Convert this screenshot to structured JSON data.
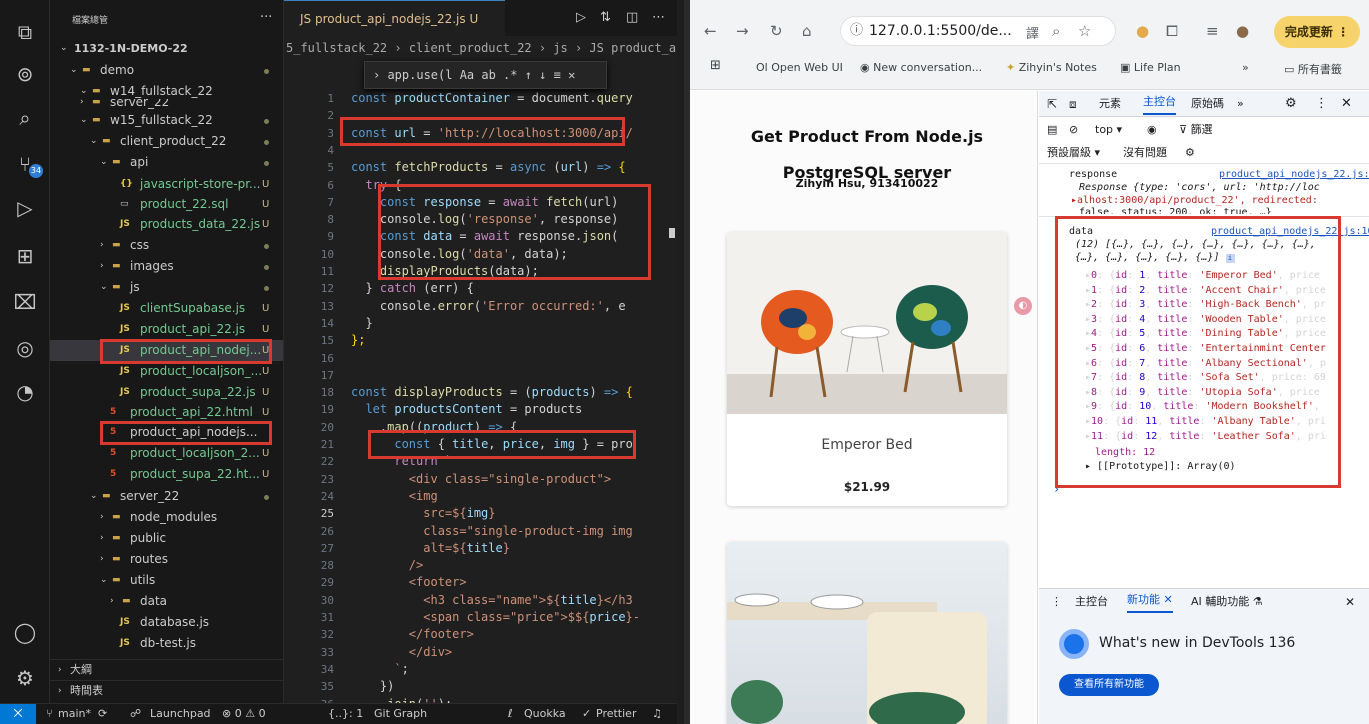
{
  "explorer": {
    "title": "檔案總管",
    "more": "···",
    "tree": [
      {
        "label": "1132-1N-DEMO-22",
        "status": "",
        "kind": "root"
      },
      {
        "label": "demo",
        "status": "dot",
        "kind": "folder"
      },
      {
        "label": "w14_fullstack_22",
        "status": "",
        "kind": "folder"
      },
      {
        "label": "server_22",
        "status": "",
        "kind": "folder"
      },
      {
        "label": "w15_fullstack_22",
        "status": "dot",
        "kind": "folder"
      },
      {
        "label": "client_product_22",
        "status": "dot",
        "kind": "folder"
      },
      {
        "label": "api",
        "status": "dot",
        "kind": "folder"
      },
      {
        "label": "javascript-store-pr...",
        "status": "U",
        "kind": "json"
      },
      {
        "label": "product_22.sql",
        "status": "U",
        "kind": "file"
      },
      {
        "label": "products_data_22.js",
        "status": "U",
        "kind": "js"
      },
      {
        "label": "css",
        "status": "dot",
        "kind": "folder"
      },
      {
        "label": "images",
        "status": "dot",
        "kind": "folder"
      },
      {
        "label": "js",
        "status": "dot",
        "kind": "folder"
      },
      {
        "label": "clientSupabase.js",
        "status": "U",
        "kind": "js"
      },
      {
        "label": "product_api_22.js",
        "status": "U",
        "kind": "js"
      },
      {
        "label": "product_api_nodej...",
        "status": "U",
        "kind": "js"
      },
      {
        "label": "product_localjson_...",
        "status": "U",
        "kind": "js"
      },
      {
        "label": "product_supa_22.js",
        "status": "U",
        "kind": "js"
      },
      {
        "label": "product_api_22.html",
        "status": "U",
        "kind": "html"
      },
      {
        "label": "product_api_nodejs...",
        "status": "",
        "kind": "html"
      },
      {
        "label": "product_localjson_2...",
        "status": "U",
        "kind": "html"
      },
      {
        "label": "product_supa_22.ht...",
        "status": "U",
        "kind": "html"
      },
      {
        "label": "server_22",
        "status": "dot",
        "kind": "folder"
      },
      {
        "label": "node_modules",
        "status": "",
        "kind": "folder"
      },
      {
        "label": "public",
        "status": "",
        "kind": "folder"
      },
      {
        "label": "routes",
        "status": "",
        "kind": "folder"
      },
      {
        "label": "utils",
        "status": "",
        "kind": "folder"
      },
      {
        "label": "data",
        "status": "",
        "kind": "folder"
      },
      {
        "label": "database.js",
        "status": "",
        "kind": "js"
      },
      {
        "label": "db-test.js",
        "status": "",
        "kind": "js"
      }
    ],
    "outline_label": "大綱",
    "timeline_label": "時間表",
    "js_glyph": "JS",
    "json_glyph": "{}",
    "html_glyph": "5"
  },
  "activity_bar": {
    "badge": "34",
    "icons": [
      "files-icon",
      "remote-explorer-icon",
      "search-icon",
      "source-control-icon",
      "run-debug-icon",
      "extensions-icon",
      "testing-icon",
      "docker-icon",
      "timeline-icon",
      "account-icon",
      "manage-gear-icon"
    ]
  },
  "editor": {
    "tab_label": "JS product_api_nodejs_22.js U",
    "breadcrumb": "5_fullstack_22 › client_product_22 › js › JS product_api_nodejs_2",
    "find_widget": "›  app.use(l  Aa  ab  .*   ↑  ↓  ≡  ✕",
    "line_numbers": [
      "1",
      "2",
      "3",
      "4",
      "5",
      "6",
      "7",
      "8",
      "9",
      "10",
      "11",
      "12",
      "13",
      "14",
      "15",
      "16",
      "17",
      "18",
      "19",
      "20",
      "21",
      "22",
      "23",
      "24",
      "25",
      "26",
      "27",
      "28",
      "29",
      "30",
      "31",
      "32",
      "33",
      "34",
      "35",
      "36"
    ],
    "code_lines": [
      [
        [
          "k",
          "const "
        ],
        [
          "v",
          "productContainer"
        ],
        [
          "p",
          " = document."
        ],
        [
          "f",
          "query"
        ]
      ],
      [],
      [
        [
          "k",
          "const "
        ],
        [
          "v",
          "url"
        ],
        [
          "p",
          " = "
        ],
        [
          "s",
          "'http://localhost:3000/api/"
        ]
      ],
      [],
      [
        [
          "k",
          "const "
        ],
        [
          "f",
          "fetchProducts"
        ],
        [
          "p",
          " = "
        ],
        [
          "k",
          "async "
        ],
        [
          "p",
          "("
        ],
        [
          "v",
          "url"
        ],
        [
          "p",
          ") "
        ],
        [
          "k",
          "=>"
        ],
        [
          "y",
          " {"
        ]
      ],
      [
        [
          "p",
          "  "
        ],
        [
          "kc",
          "try"
        ],
        [
          "p",
          " {"
        ]
      ],
      [
        [
          "p",
          "    "
        ],
        [
          "k",
          "const "
        ],
        [
          "v",
          "response"
        ],
        [
          "p",
          " = "
        ],
        [
          "kc",
          "await "
        ],
        [
          "f",
          "fetch"
        ],
        [
          "p",
          "(url)"
        ]
      ],
      [
        [
          "p",
          "    console."
        ],
        [
          "f",
          "log"
        ],
        [
          "p",
          "("
        ],
        [
          "s",
          "'response'"
        ],
        [
          "p",
          ", response)"
        ]
      ],
      [
        [
          "p",
          "    "
        ],
        [
          "k",
          "const "
        ],
        [
          "v",
          "data"
        ],
        [
          "p",
          " = "
        ],
        [
          "kc",
          "await "
        ],
        [
          "p",
          "response."
        ],
        [
          "f",
          "json"
        ],
        [
          "p",
          "("
        ]
      ],
      [
        [
          "p",
          "    console."
        ],
        [
          "f",
          "log"
        ],
        [
          "p",
          "("
        ],
        [
          "s",
          "'data'"
        ],
        [
          "p",
          ", data);"
        ]
      ],
      [
        [
          "p",
          "    "
        ],
        [
          "f",
          "displayProducts"
        ],
        [
          "p",
          "(data);"
        ]
      ],
      [
        [
          "p",
          "  } "
        ],
        [
          "kc",
          "catch "
        ],
        [
          "p",
          "(err) {"
        ]
      ],
      [
        [
          "p",
          "    console."
        ],
        [
          "f",
          "error"
        ],
        [
          "p",
          "("
        ],
        [
          "s",
          "'Error occurred:'"
        ],
        [
          "p",
          ", e"
        ]
      ],
      [
        [
          "p",
          "  }"
        ]
      ],
      [
        [
          "y",
          "};"
        ]
      ],
      [],
      [],
      [
        [
          "k",
          "const "
        ],
        [
          "f",
          "displayProducts"
        ],
        [
          "p",
          " = ("
        ],
        [
          "v",
          "products"
        ],
        [
          "p",
          ") "
        ],
        [
          "k",
          "=>"
        ],
        [
          "y",
          " {"
        ]
      ],
      [
        [
          "p",
          "  "
        ],
        [
          "k",
          "let "
        ],
        [
          "v",
          "productsContent"
        ],
        [
          "p",
          " = products"
        ]
      ],
      [
        [
          "p",
          "    ."
        ],
        [
          "f",
          "map"
        ],
        [
          "p",
          "(("
        ],
        [
          "v",
          "product"
        ],
        [
          "p",
          ") "
        ],
        [
          "k",
          "=>"
        ],
        [
          "p",
          " {"
        ]
      ],
      [
        [
          "p",
          "      "
        ],
        [
          "k",
          "const "
        ],
        [
          "p",
          "{ "
        ],
        [
          "v",
          "title"
        ],
        [
          "p",
          ", "
        ],
        [
          "v",
          "price"
        ],
        [
          "p",
          ", "
        ],
        [
          "v",
          "img"
        ],
        [
          "p",
          " } = pro"
        ]
      ],
      [
        [
          "p",
          "      "
        ],
        [
          "kc",
          "return "
        ],
        [
          "s",
          "`"
        ]
      ],
      [
        [
          "s",
          "        <div class=\"single-product\">"
        ]
      ],
      [
        [
          "s",
          "        <img"
        ]
      ],
      [
        [
          "s",
          "          src=${"
        ],
        [
          "v",
          "img"
        ],
        [
          "s",
          "}"
        ]
      ],
      [
        [
          "s",
          "          class=\"single-product-img img"
        ]
      ],
      [
        [
          "s",
          "          alt=${"
        ],
        [
          "v",
          "title"
        ],
        [
          "s",
          "}"
        ]
      ],
      [
        [
          "s",
          "        />"
        ]
      ],
      [
        [
          "s",
          "        <footer>"
        ]
      ],
      [
        [
          "s",
          "          <h3 class=\"name\">${"
        ],
        [
          "v",
          "title"
        ],
        [
          "s",
          "}</h3"
        ]
      ],
      [
        [
          "s",
          "          <span class=\"price\">$${"
        ],
        [
          "v",
          "price"
        ],
        [
          "s",
          "}-"
        ]
      ],
      [
        [
          "s",
          "        </footer>"
        ]
      ],
      [
        [
          "s",
          "        </div>"
        ]
      ],
      [
        [
          "s",
          "      `"
        ],
        [
          "p",
          ";"
        ]
      ],
      [
        [
          "p",
          "    })"
        ]
      ],
      [
        [
          "p",
          "    ."
        ],
        [
          "f",
          "join"
        ],
        [
          "p",
          "("
        ],
        [
          "s",
          "''"
        ],
        [
          "p",
          ");"
        ]
      ]
    ]
  },
  "status_bar": {
    "branch": "main*",
    "launchpad": "Launchpad",
    "problems": "⊗ 0 ⚠ 0",
    "lang": "{..}: 1",
    "git_graph": "Git Graph",
    "quokka": "Quokka",
    "prettier": "Prettier"
  },
  "browser": {
    "url": "127.0.0.1:5500/de...",
    "update_button": "完成更新",
    "bookmarks": [
      {
        "icon": "ollama-icon",
        "label": "Open Web UI"
      },
      {
        "icon": "github-icon",
        "label": "New conversation..."
      },
      {
        "icon": "star-icon",
        "label": "Zihyin's Notes"
      },
      {
        "icon": "planner-icon",
        "label": "Life Plan"
      }
    ],
    "bookmarks_overflow": "»",
    "all_bookmarks": "所有書籤"
  },
  "page": {
    "title": "Get Product From Node.js PostgreSQL server",
    "subtitle": "Zihyin Hsu, 913410022",
    "product_name": "Emperor Bed",
    "product_price": "$21.99"
  },
  "devtools": {
    "tabs": [
      "元素",
      "主控台",
      "原始碼"
    ],
    "active_tab": "主控台",
    "more_tabs": "»",
    "context": "top",
    "filter": "篩選",
    "levels": "預設層級",
    "issues": "沒有問題",
    "resp_label": "response",
    "resp_link": "product_api_nodejs_22.js:8",
    "resp_line1": "Response {type: 'cors', url: 'http://loc",
    "resp_line2": "▸alhost:3000/api/product_22', redirected:",
    "resp_line3": "false, status: 200, ok: true, …}",
    "data_label": "data",
    "data_link": "product_api_nodejs_22.js:10",
    "data_summary1": "(12) [{…}, {…}, {…}, {…}, {…}, {…}, {…},",
    "data_summary2": "{…}, {…}, {…}, {…}, {…}]",
    "items": [
      {
        "idx": "0",
        "id": "1",
        "title": "'Emperor Bed'",
        "tail": ", price"
      },
      {
        "idx": "1",
        "id": "2",
        "title": "'Accent Chair'",
        "tail": ", price"
      },
      {
        "idx": "2",
        "id": "3",
        "title": "'High-Back Bench'",
        "tail": ", pr"
      },
      {
        "idx": "3",
        "id": "4",
        "title": "'Wooden Table'",
        "tail": ", price"
      },
      {
        "idx": "4",
        "id": "5",
        "title": "'Dining Table'",
        "tail": ", price"
      },
      {
        "idx": "5",
        "id": "6",
        "title": "'Entertainmint Center",
        "tail": ""
      },
      {
        "idx": "6",
        "id": "7",
        "title": "'Albany Sectional'",
        "tail": ", p"
      },
      {
        "idx": "7",
        "id": "8",
        "title": "'Sofa Set'",
        "tail": ", price: 69"
      },
      {
        "idx": "8",
        "id": "9",
        "title": "'Utopia Sofa'",
        "tail": ", price"
      },
      {
        "idx": "9",
        "id": "10",
        "title": "'Modern Bookshelf'",
        "tail": ","
      },
      {
        "idx": "10",
        "id": "11",
        "title": "'Albany Table'",
        "tail": ", pri"
      },
      {
        "idx": "11",
        "id": "12",
        "title": "'Leather Sofa'",
        "tail": ", pri"
      }
    ],
    "length_line": "length: 12",
    "proto_line": "▸ [[Prototype]]: Array(0)",
    "prompt": "›",
    "drawer_tabs": [
      "主控台",
      "新功能",
      "AI 輔助功能"
    ],
    "whats_new": "What's new in DevTools 136",
    "whats_new_btn": "查看所有新功能"
  }
}
